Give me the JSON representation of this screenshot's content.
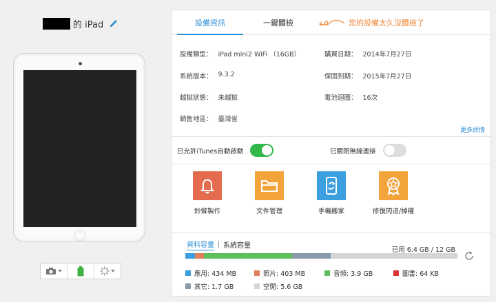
{
  "device": {
    "name_suffix": "的 iPad"
  },
  "tabs": {
    "info": "設備資訊",
    "check": "一鍵體檢",
    "check_message": "您的設備太久沒體檢了"
  },
  "info": {
    "type_label": "設備類型：",
    "type_value": "iPad mini2 WiFi （16GB）",
    "purchase_label": "購買日期：",
    "purchase_value": "2014年7月27日",
    "version_label": "系統版本：",
    "version_value": "9.3.2",
    "warranty_label": "保固到期：",
    "warranty_value": "2015年7月27日",
    "jailbreak_label": "越獄狀態：",
    "jailbreak_value": "未越獄",
    "battery_label": "電池迴圈：",
    "battery_value": "16次",
    "region_label": "銷售地區：",
    "region_value": "臺灣省",
    "more_link": "更多詳情"
  },
  "toggles": {
    "itunes_label": "已允許iTunes自動啟動",
    "itunes_on": true,
    "wireless_label": "已關閉無線連接",
    "wireless_on": false
  },
  "tools": [
    {
      "label": "鈴聲製作",
      "icon": "bell-icon",
      "color": "#e36b4e"
    },
    {
      "label": "文件管理",
      "icon": "folder-icon",
      "color": "#f2a33a"
    },
    {
      "label": "手機搬家",
      "icon": "phone-transfer-icon",
      "color": "#3b9fe0"
    },
    {
      "label": "修復閃退/掉權",
      "icon": "repair-badge-icon",
      "color": "#f2a33a"
    }
  ],
  "storage": {
    "tab_data": "資料容量",
    "tab_system": "系統容量",
    "used_text": "已用 6.4 GB / 12 GB",
    "total_gb": 12,
    "segments": [
      {
        "label": "應用: 434 MB",
        "mb": 434,
        "color": "#3ca0e0"
      },
      {
        "label": "照片: 403 MB",
        "mb": 403,
        "color": "#e0805a"
      },
      {
        "label": "音頻: 3.9 GB",
        "mb": 3994,
        "color": "#5cbf5c"
      },
      {
        "label": "圖書: 64 KB",
        "mb": 0.06,
        "color": "#d93636"
      },
      {
        "label": "其它: 1.7 GB",
        "mb": 1741,
        "color": "#8a9aa8"
      },
      {
        "label": "空閒: 5.6 GB",
        "mb": 5734,
        "color": "#d5d5d5"
      }
    ]
  }
}
